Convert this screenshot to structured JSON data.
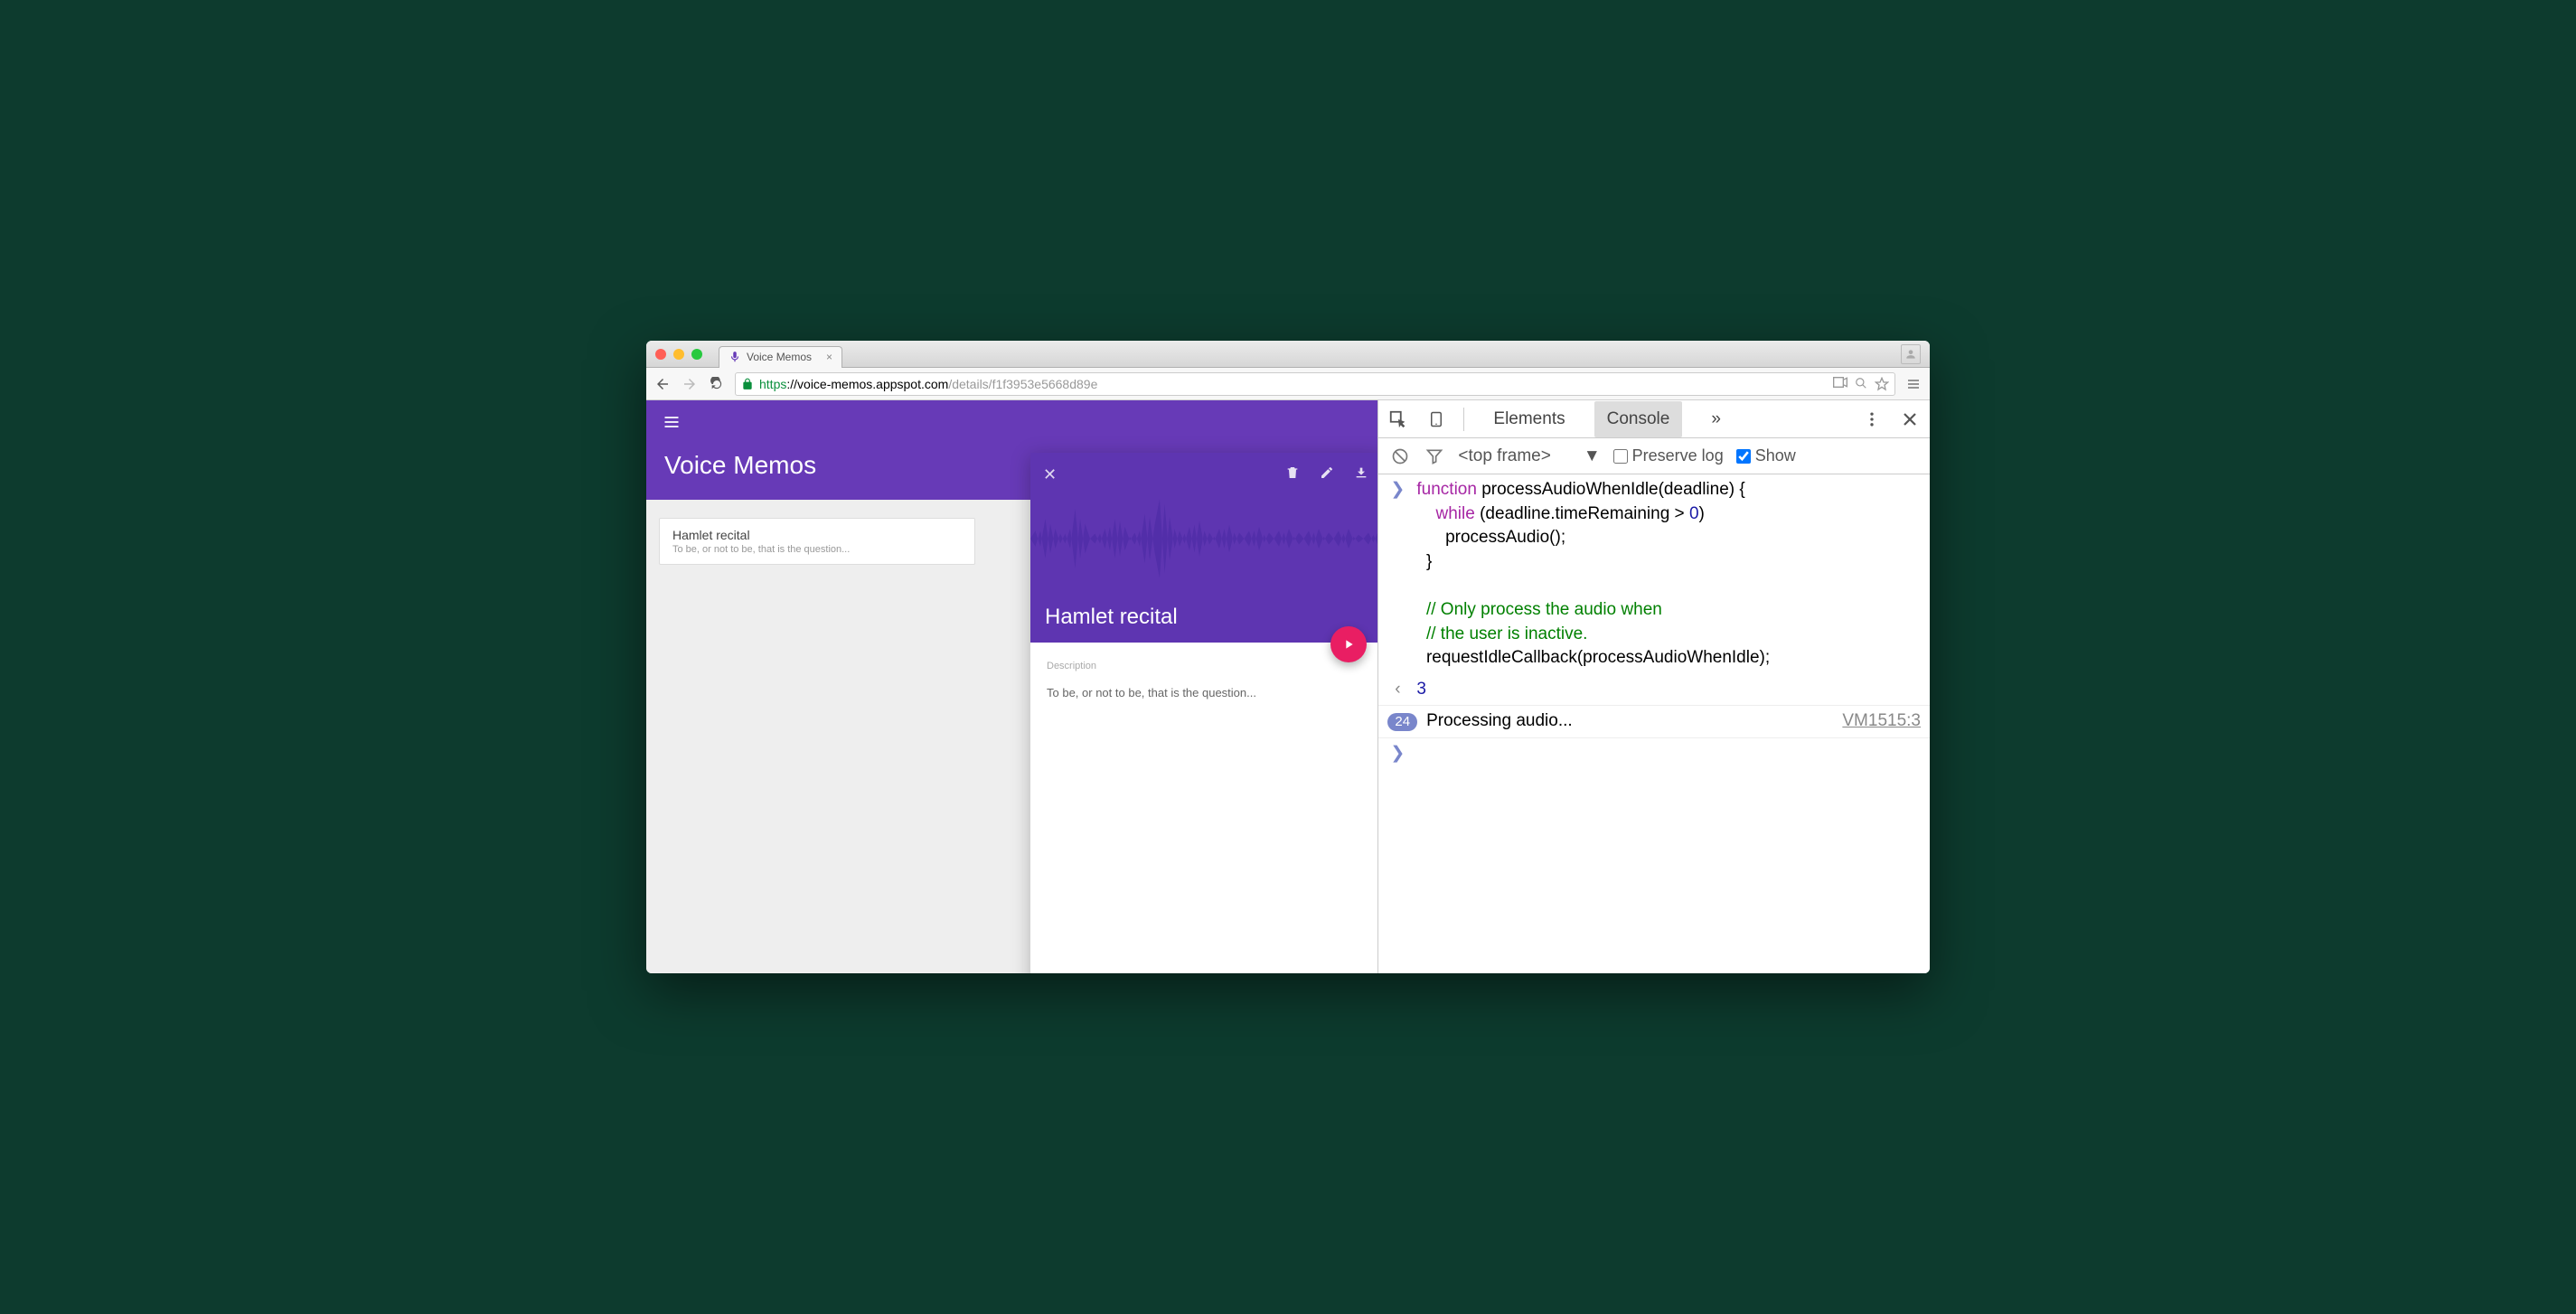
{
  "browser": {
    "tab_title": "Voice Memos",
    "url_scheme": "https",
    "url_host": "://voice-memos.appspot.com",
    "url_path": "/details/f1f3953e5668d89e"
  },
  "app": {
    "title": "Voice Memos",
    "list_item": {
      "title": "Hamlet recital",
      "subtitle": "To be, or not to be, that is the question..."
    },
    "detail": {
      "title": "Hamlet recital",
      "desc_label": "Description",
      "desc_text": "To be, or not to be, that is the question..."
    }
  },
  "devtools": {
    "tabs": {
      "elements": "Elements",
      "console": "Console",
      "more": "»"
    },
    "filter_frame": "<top frame>",
    "preserve_label": "Preserve log",
    "show_label": "Show",
    "code": "function processAudioWhenIdle(deadline) {\n    while (deadline.timeRemaining > 0)\n      processAudio();\n  }\n\n  // Only process the audio when\n  // the user is inactive.\n  requestIdleCallback(processAudioWhenIdle);",
    "return_val": "3",
    "msg_count": "24",
    "msg_text": "Processing audio...",
    "msg_src": "VM1515:3"
  }
}
